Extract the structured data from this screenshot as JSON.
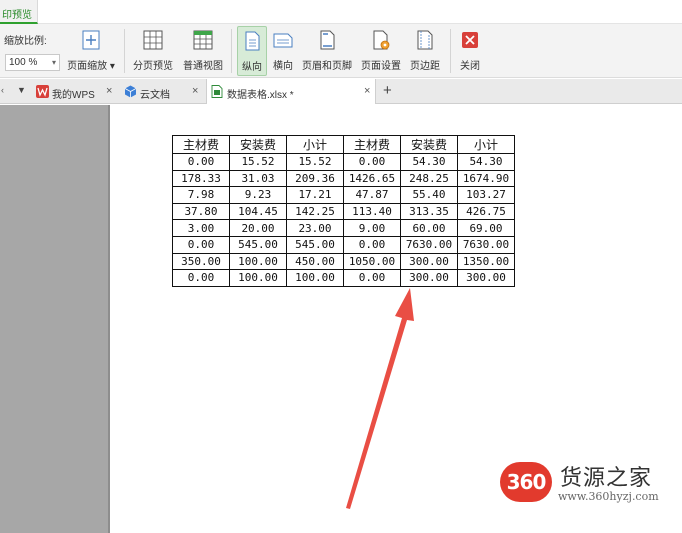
{
  "top_tab": {
    "label": "印预览"
  },
  "ribbon": {
    "zoom_label": "缩放比例:",
    "zoom_value": "100 %",
    "buttons": {
      "page_zoom": "页面缩放",
      "page_break_preview": "分页预览",
      "normal_view": "普通视图",
      "portrait": "纵向",
      "landscape": "横向",
      "header_footer": "页眉和页脚",
      "page_setup": "页面设置",
      "margins": "页边距",
      "close": "关闭"
    }
  },
  "doc_tabs": {
    "items": [
      {
        "label": "我的WPS"
      },
      {
        "label": "云文档"
      },
      {
        "label": "数据表格.xlsx *"
      }
    ],
    "add_label": "+"
  },
  "sheet": {
    "headers": [
      "主材费",
      "安装费",
      "小计",
      "主材费",
      "安装费",
      "小计"
    ],
    "rows": [
      [
        "0.00",
        "15.52",
        "15.52",
        "0.00",
        "54.30",
        "54.30"
      ],
      [
        "178.33",
        "31.03",
        "209.36",
        "1426.65",
        "248.25",
        "1674.90"
      ],
      [
        "7.98",
        "9.23",
        "17.21",
        "47.87",
        "55.40",
        "103.27"
      ],
      [
        "37.80",
        "104.45",
        "142.25",
        "113.40",
        "313.35",
        "426.75"
      ],
      [
        "3.00",
        "20.00",
        "23.00",
        "9.00",
        "60.00",
        "69.00"
      ],
      [
        "0.00",
        "545.00",
        "545.00",
        "0.00",
        "7630.00",
        "7630.00"
      ],
      [
        "350.00",
        "100.00",
        "450.00",
        "1050.00",
        "300.00",
        "1350.00"
      ],
      [
        "0.00",
        "100.00",
        "100.00",
        "0.00",
        "300.00",
        "300.00"
      ]
    ]
  },
  "watermark": {
    "badge": "360",
    "name": "货源之家",
    "url": "www.360hyzj.com"
  },
  "colors": {
    "accent_green": "#2fa12f",
    "arrow_red": "#e8443a",
    "badge_red": "#e23a2d"
  }
}
